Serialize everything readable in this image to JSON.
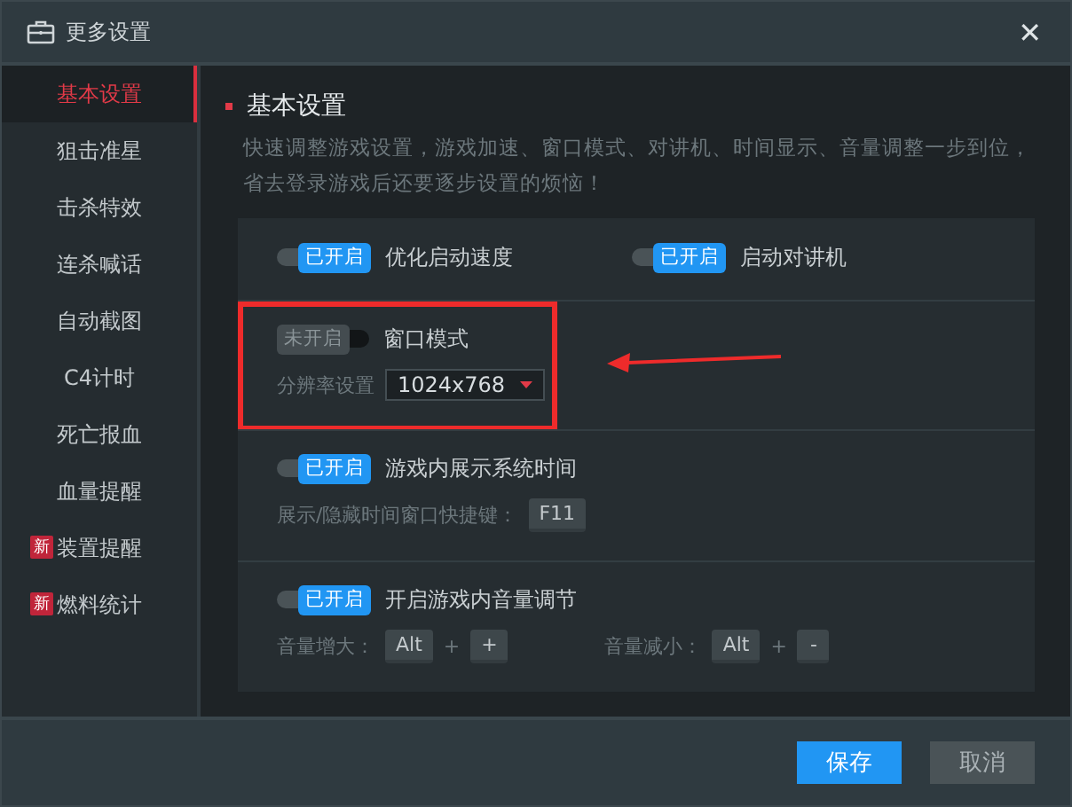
{
  "window": {
    "title": "更多设置",
    "close": "✕"
  },
  "sidebar": {
    "items": [
      {
        "label": "基本设置",
        "selected": true
      },
      {
        "label": "狙击准星",
        "selected": false
      },
      {
        "label": "击杀特效",
        "selected": false
      },
      {
        "label": "连杀喊话",
        "selected": false
      },
      {
        "label": "自动截图",
        "selected": false
      },
      {
        "label": "C4计时",
        "selected": false
      },
      {
        "label": "死亡报血",
        "selected": false
      },
      {
        "label": "血量提醒",
        "selected": false
      },
      {
        "label": "装置提醒",
        "selected": false,
        "badge": "新"
      },
      {
        "label": "燃料统计",
        "selected": false,
        "badge": "新"
      }
    ]
  },
  "content": {
    "heading": "基本设置",
    "description": "快速调整游戏设置，游戏加速、窗口模式、对讲机、时间显示、音量调整一步到位，省去登录游戏后还要逐步设置的烦恼！",
    "sections": [
      {
        "highlighted": false,
        "toggles": [
          {
            "state_label": "已开启",
            "on": true,
            "label": "优化启动速度"
          },
          {
            "state_label": "已开启",
            "on": true,
            "label": "启动对讲机"
          }
        ]
      },
      {
        "highlighted": true,
        "toggles": [
          {
            "state_label": "未开启",
            "on": false,
            "label": "窗口模式"
          }
        ],
        "details": [
          {
            "kind": "dropdown",
            "label": "分辨率设置",
            "value": "1024x768"
          }
        ]
      },
      {
        "highlighted": false,
        "toggles": [
          {
            "state_label": "已开启",
            "on": true,
            "label": "游戏内展示系统时间"
          }
        ],
        "details": [
          {
            "kind": "keys",
            "label": "展示/隐藏时间窗口快捷键：",
            "keys": [
              "F11"
            ]
          }
        ]
      },
      {
        "highlighted": false,
        "toggles": [
          {
            "state_label": "已开启",
            "on": true,
            "label": "开启游戏内音量调节"
          }
        ],
        "details": [
          {
            "kind": "keys",
            "label": "音量增大：",
            "keys": [
              "Alt",
              "+"
            ],
            "separators": [
              "+"
            ]
          },
          {
            "kind": "keys",
            "label": "音量减小：",
            "keys": [
              "Alt",
              "-"
            ],
            "separators": [
              "+"
            ]
          }
        ]
      }
    ]
  },
  "footer": {
    "buttons": [
      {
        "label": "保存",
        "kind": "primary"
      },
      {
        "label": "取消",
        "kind": "secondary"
      }
    ]
  }
}
